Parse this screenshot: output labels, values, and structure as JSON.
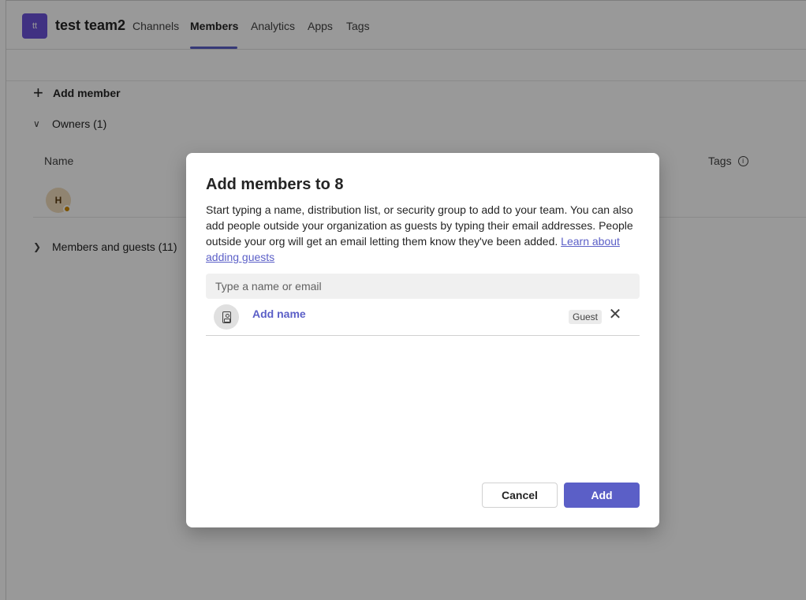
{
  "colors": {
    "accent": "#5b5fc7",
    "team_avatar_bg": "#6b52d9",
    "owner_avatar_bg": "#f1dcbc",
    "presence_away": "#d08a00"
  },
  "header": {
    "team_initials": "tt",
    "team_name": "test team2",
    "tabs": [
      {
        "label": "Channels"
      },
      {
        "label": "Members",
        "active": true
      },
      {
        "label": "Analytics"
      },
      {
        "label": "Apps"
      },
      {
        "label": "Tags"
      }
    ]
  },
  "members_page": {
    "add_member_label": "Add member",
    "owners_label": "Owners (1)",
    "column_name": "Name",
    "column_tags": "Tags",
    "owner_initial": "H",
    "members_and_guests_label": "Members and guests (11)"
  },
  "dialog": {
    "title": "Add members to 8",
    "description": "Start typing a name, distribution list, or security group to add to your team. You can also add people outside your organization as guests by typing their email addresses. People outside your org will get an email letting them know they've been added.",
    "learn_more_link": "Learn about adding guests",
    "search_placeholder": "Type a name or email",
    "selected": {
      "name": "Add name",
      "badge": "Guest",
      "remove_glyph": "✕"
    },
    "cancel_label": "Cancel",
    "add_label": "Add"
  },
  "icons": {
    "plus": "plus-icon",
    "chevron_down": "chevron-down-icon",
    "chevron_right": "chevron-right-icon",
    "info": "info-icon",
    "contact_card": "contact-card-icon",
    "close": "close-icon"
  }
}
